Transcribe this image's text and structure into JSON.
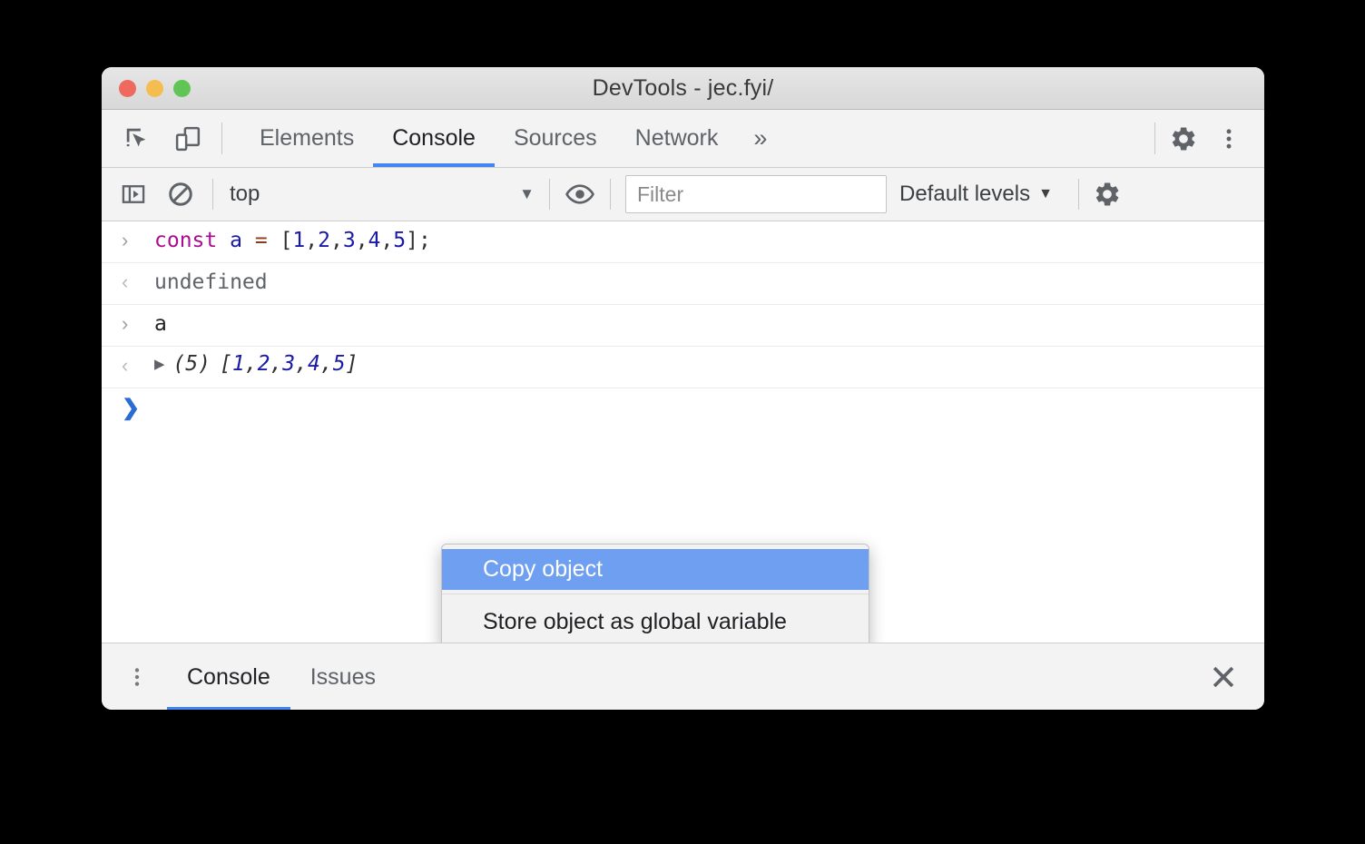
{
  "window": {
    "title": "DevTools - jec.fyi/",
    "traffic_lights": [
      {
        "name": "close",
        "color": "#ee6a5f"
      },
      {
        "name": "minimize",
        "color": "#f5bd4f"
      },
      {
        "name": "zoom",
        "color": "#61c555"
      }
    ]
  },
  "toolbar": {
    "inspect_icon": "inspect-element-icon",
    "device_icon": "device-toolbar-icon",
    "more_tabs_label": "»",
    "settings_icon": "gear-icon",
    "more_options_icon": "kebab-menu-icon",
    "tabs": [
      {
        "label": "Elements",
        "active": false
      },
      {
        "label": "Console",
        "active": true
      },
      {
        "label": "Sources",
        "active": false
      },
      {
        "label": "Network",
        "active": false
      }
    ],
    "accent_color": "#4285f4"
  },
  "console_toolbar": {
    "sidebar_toggle_icon": "console-sidebar-toggle-icon",
    "clear_icon": "clear-console-icon",
    "context": {
      "value": "top",
      "caret": "▼"
    },
    "eye_icon": "live-expression-eye-icon",
    "filter": {
      "value": "",
      "placeholder": "Filter"
    },
    "levels": {
      "label": "Default levels",
      "caret": "▼"
    },
    "settings_icon": "console-settings-gear-icon"
  },
  "console": {
    "messages": [
      {
        "type": "input",
        "gutter": "›",
        "tokens": [
          {
            "text": "const",
            "cls": "tok-keyword"
          },
          {
            "text": " ",
            "cls": "tok-plain"
          },
          {
            "text": "a",
            "cls": "tok-var"
          },
          {
            "text": " ",
            "cls": "tok-plain"
          },
          {
            "text": "=",
            "cls": "tok-op"
          },
          {
            "text": " [",
            "cls": "tok-plain"
          },
          {
            "text": "1",
            "cls": "tok-num"
          },
          {
            "text": ",",
            "cls": "tok-plain"
          },
          {
            "text": "2",
            "cls": "tok-num"
          },
          {
            "text": ",",
            "cls": "tok-plain"
          },
          {
            "text": "3",
            "cls": "tok-num"
          },
          {
            "text": ",",
            "cls": "tok-plain"
          },
          {
            "text": "4",
            "cls": "tok-num"
          },
          {
            "text": ",",
            "cls": "tok-plain"
          },
          {
            "text": "5",
            "cls": "tok-num"
          },
          {
            "text": "];",
            "cls": "tok-plain"
          }
        ]
      },
      {
        "type": "output",
        "gutter": "‹",
        "text": "undefined"
      },
      {
        "type": "input",
        "gutter": "›",
        "text": "a"
      },
      {
        "type": "result_array",
        "gutter": "‹",
        "disclosure": "▶",
        "count_label": "(5)",
        "open_bracket": "[",
        "items": [
          "1",
          "2",
          "3",
          "4",
          "5"
        ],
        "separator": ", ",
        "close_bracket": "]"
      },
      {
        "type": "prompt",
        "gutter": "❯",
        "text": ""
      }
    ]
  },
  "context_menu": {
    "highlight_color": "#6e9ff0",
    "items": [
      {
        "label": "Copy object",
        "selected": true
      },
      {
        "label": "Store object as global variable",
        "selected": false
      }
    ]
  },
  "drawer": {
    "more_icon": "kebab-menu-icon",
    "tabs": [
      {
        "label": "Console",
        "active": true
      },
      {
        "label": "Issues",
        "active": false
      }
    ],
    "close_icon": "close-icon"
  }
}
